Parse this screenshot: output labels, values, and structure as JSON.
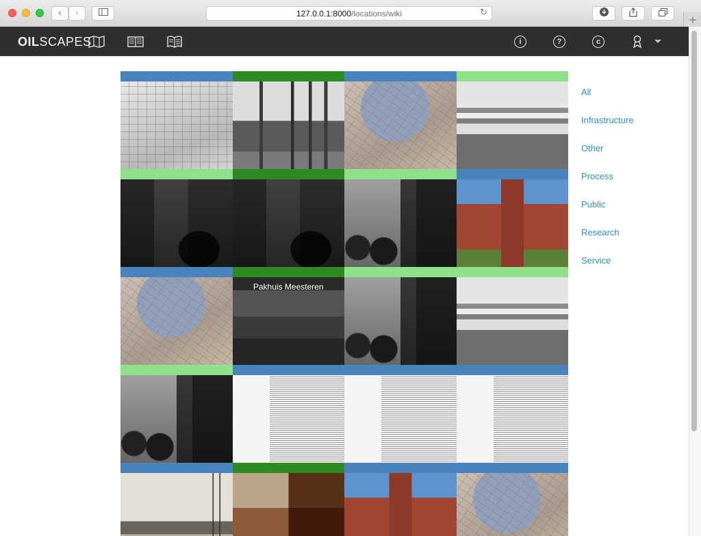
{
  "browser": {
    "url_host": "127.0.0.1:8000",
    "url_path": "/locations/wiki",
    "back_icon": "chevron-left-icon",
    "forward_icon": "chevron-right-icon",
    "sidebar_icon": "sidebar-icon",
    "reload_icon": "reload-icon",
    "download_icon": "download-icon",
    "share_icon": "share-icon",
    "tabs_icon": "tabs-icon",
    "new_tab_label": "+"
  },
  "app": {
    "logo_bold": "OIL",
    "logo_rest": "SCAPES",
    "nav_icons": [
      "map-icon",
      "book-open-icon",
      "book-icon"
    ],
    "right_icons": [
      {
        "name": "info-icon",
        "glyph": "i"
      },
      {
        "name": "help-icon",
        "glyph": "?"
      },
      {
        "name": "copyright-icon",
        "glyph": "c"
      },
      {
        "name": "user-icon"
      }
    ]
  },
  "colors": {
    "infrastructure": "#4a82bd",
    "process": "#2e8b22",
    "public": "#8fe08a",
    "link": "#2f8fc0"
  },
  "tiles": [
    {
      "category": "infrastructure",
      "image": "city map"
    },
    {
      "category": "process",
      "image": "refinery"
    },
    {
      "category": "infrastructure",
      "image": "harbour map"
    },
    {
      "category": "public",
      "image": "modern building"
    },
    {
      "category": "public",
      "image": "street scene"
    },
    {
      "category": "process",
      "image": "street scene with kiosk"
    },
    {
      "category": "public",
      "image": "vintage car"
    },
    {
      "category": "infrastructure",
      "image": "brick building"
    },
    {
      "category": "infrastructure",
      "image": "harbour map"
    },
    {
      "category": "process",
      "image": "harbour",
      "label": "Pakhuis Meesteren"
    },
    {
      "category": "public",
      "image": "vintage car"
    },
    {
      "category": "public",
      "image": "modern building"
    },
    {
      "category": "public",
      "image": "vintage car"
    },
    {
      "category": "infrastructure",
      "image": "book pages"
    },
    {
      "category": "infrastructure",
      "image": "book pages"
    },
    {
      "category": "infrastructure",
      "image": "book pages"
    },
    {
      "category": "infrastructure",
      "image": "sailing ships"
    },
    {
      "category": "process",
      "image": "factory"
    },
    {
      "category": "infrastructure",
      "image": "brick building"
    },
    {
      "category": "infrastructure",
      "image": "harbour map"
    }
  ],
  "filters": [
    "All",
    "Infrastructure",
    "Other",
    "Process",
    "Public",
    "Research",
    "Service"
  ]
}
